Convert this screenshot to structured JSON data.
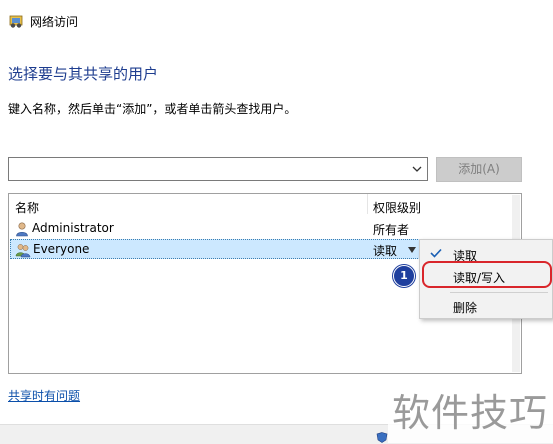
{
  "window": {
    "title": "网络访问",
    "icon": "network-share-icon"
  },
  "heading": "选择要与其共享的用户",
  "instruction": "键入名称，然后单击“添加”，或者单击箭头查找用户。",
  "name_input": {
    "value": "",
    "placeholder": ""
  },
  "add_button": {
    "label": "添加(A)",
    "enabled": false
  },
  "table": {
    "columns": [
      "名称",
      "权限级别"
    ],
    "rows": [
      {
        "name": "Administrator",
        "permission": "所有者",
        "icon": "user-icon",
        "selected": false
      },
      {
        "name": "Everyone",
        "permission": "读取",
        "icon": "group-users-icon",
        "selected": true
      }
    ]
  },
  "permission_menu": {
    "items": [
      {
        "label": "读取",
        "checked": true
      },
      {
        "label": "读取/写入",
        "checked": false,
        "highlighted": true
      },
      {
        "label": "删除",
        "checked": false
      }
    ]
  },
  "step_marker": "1",
  "help_link": "共享时有问题",
  "watermark": "软件技巧",
  "colors": {
    "heading": "#1e3d8f",
    "selection": "#cce8ff",
    "highlight_ring": "#d9262b",
    "step_badge": "#1f3f9e",
    "link": "#0b4faa"
  }
}
